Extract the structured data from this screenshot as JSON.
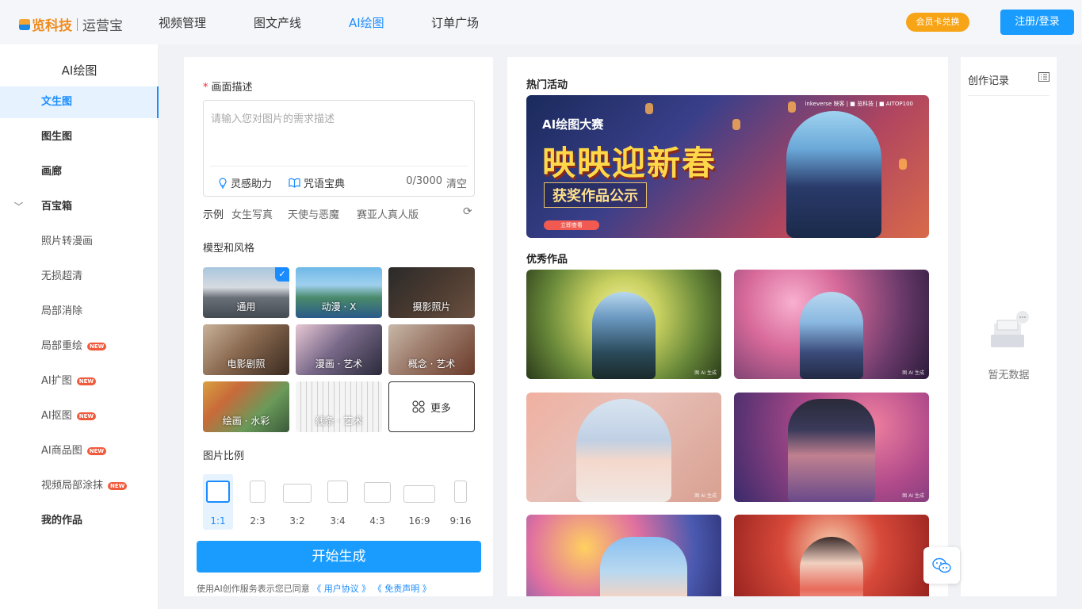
{
  "header": {
    "logo_brand": "览科技",
    "logo_product": "运营宝",
    "nav": [
      "视频管理",
      "图文产线",
      "AI绘图",
      "订单广场"
    ],
    "active_nav": "AI绘图",
    "vip_button": "会员卡兑换",
    "login_button": "注册/登录"
  },
  "sidebar": {
    "title": "AI绘图",
    "items": [
      {
        "label": "文生图",
        "state": "active"
      },
      {
        "label": "图生图"
      },
      {
        "label": "画廊"
      },
      {
        "label": "百宝箱",
        "expanded": true
      },
      {
        "label": "照片转漫画"
      },
      {
        "label": "无损超清"
      },
      {
        "label": "局部消除"
      },
      {
        "label": "局部重绘",
        "badge": "NEW"
      },
      {
        "label": "AI扩图",
        "badge": "NEW"
      },
      {
        "label": "AI抠图",
        "badge": "NEW"
      },
      {
        "label": "AI商品图",
        "badge": "NEW"
      },
      {
        "label": "视频局部涂抹",
        "badge": "NEW"
      },
      {
        "label": "我的作品"
      }
    ]
  },
  "form": {
    "desc_label": "画面描述",
    "desc_placeholder": "请输入您对图片的需求描述",
    "tool_inspire": "灵感助力",
    "tool_spell": "咒语宝典",
    "counter": "0/3000",
    "clear": "清空",
    "examples_label": "示例",
    "examples": [
      "女生写真",
      "天使与恶魔",
      "赛亚人真人版"
    ],
    "style_label": "模型和风格",
    "styles": [
      {
        "label": "通用",
        "selected": true
      },
      {
        "label": "动漫 · X"
      },
      {
        "label": "摄影照片"
      },
      {
        "label": "电影剧照"
      },
      {
        "label": "漫画 · 艺术"
      },
      {
        "label": "概念 · 艺术"
      },
      {
        "label": "绘画 · 水彩"
      },
      {
        "label": "线条 · 艺术"
      }
    ],
    "more_label": "更多",
    "ratio_label": "图片比例",
    "ratios": [
      "1:1",
      "2:3",
      "3:2",
      "3:4",
      "4:3",
      "16:9",
      "9:16"
    ],
    "selected_ratio": "1:1",
    "generate": "开始生成",
    "agree_prefix": "使用AI创作服务表示您已同意",
    "agree_link1": "《 用户协议 》",
    "agree_link2": "《 免责声明 》"
  },
  "gallery": {
    "hot_title": "热门活动",
    "banner": {
      "sub": "AI绘图大赛",
      "title": "映映迎新春",
      "prize": "获奖作品公示",
      "button": "立即查看",
      "logos": "inkeverse 映客 | ■ 览科技 | ■ AITOP100"
    },
    "works_title": "优秀作品",
    "watermark": "图 AI 生成"
  },
  "records": {
    "title": "创作记录",
    "empty": "暂无数据"
  },
  "colors": {
    "accent": "#1a8cff",
    "vip": "#f7a416",
    "new_badge": "#f05a3c"
  }
}
